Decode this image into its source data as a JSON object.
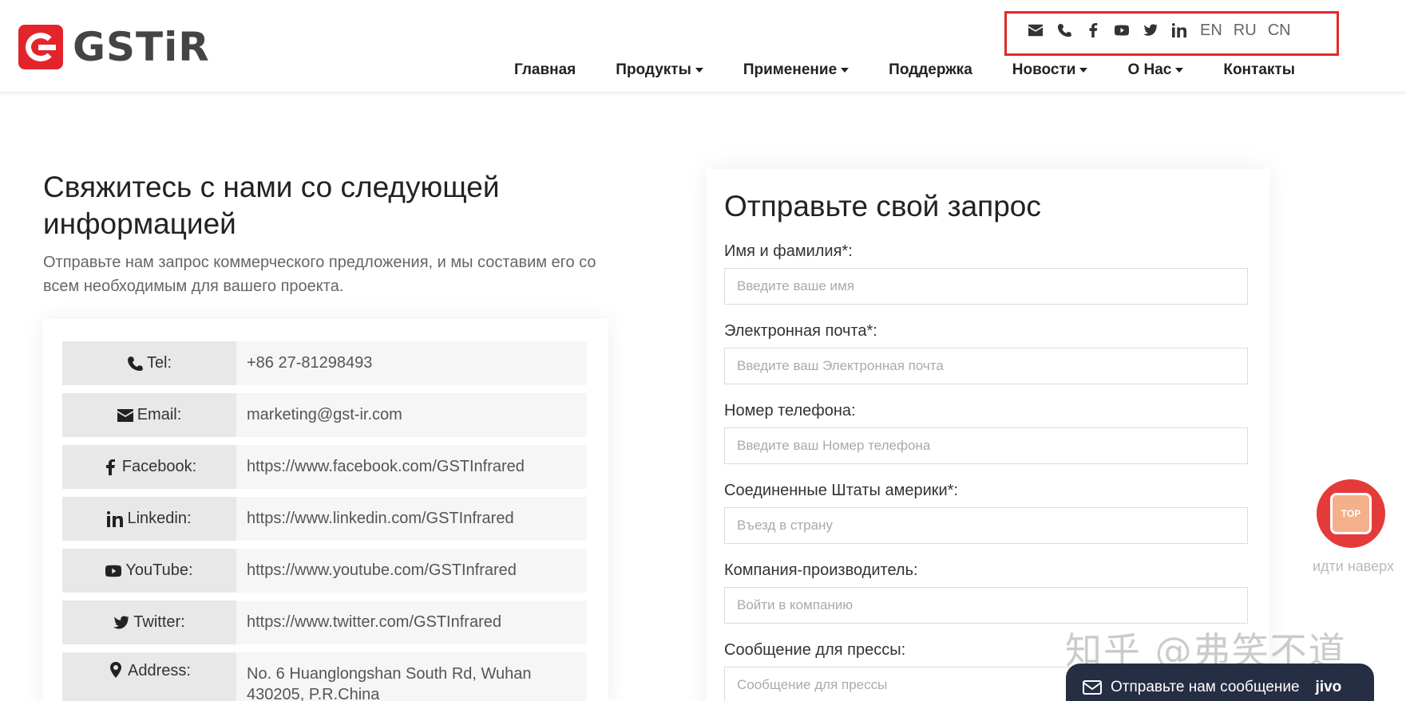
{
  "brand": {
    "logo_text": "GSTiR",
    "accent_color": "#e3242b"
  },
  "topbar": {
    "icons": [
      "envelope-icon",
      "phone-icon",
      "facebook-icon",
      "youtube-icon",
      "twitter-icon",
      "linkedin-icon"
    ],
    "languages": [
      "EN",
      "RU",
      "CN"
    ],
    "highlight_color": "#e02a2a"
  },
  "nav": {
    "items": [
      {
        "label": "Главная",
        "dropdown": false
      },
      {
        "label": "Продукты",
        "dropdown": true
      },
      {
        "label": "Применение",
        "dropdown": true
      },
      {
        "label": "Поддержка",
        "dropdown": false
      },
      {
        "label": "Новости",
        "dropdown": true
      },
      {
        "label": "О Нас",
        "dropdown": true
      },
      {
        "label": "Контакты",
        "dropdown": false
      }
    ]
  },
  "contact": {
    "title": "Свяжитесь с нами со следующей информацией",
    "description": "Отправьте нам запрос коммерческого предложения, и мы составим его со всем необходимым для вашего проекта.",
    "rows": [
      {
        "icon": "phone-icon",
        "label": "Tel:",
        "value": "+86 27-81298493"
      },
      {
        "icon": "envelope-icon",
        "label": "Email:",
        "value": "marketing@gst-ir.com"
      },
      {
        "icon": "facebook-icon",
        "label": "Facebook:",
        "value": "https://www.facebook.com/GSTInfrared"
      },
      {
        "icon": "linkedin-icon",
        "label": "Linkedin:",
        "value": "https://www.linkedin.com/GSTInfrared"
      },
      {
        "icon": "youtube-icon",
        "label": "YouTube:",
        "value": "https://www.youtube.com/GSTInfrared"
      },
      {
        "icon": "twitter-icon",
        "label": "Twitter:",
        "value": "https://www.twitter.com/GSTInfrared"
      },
      {
        "icon": "map-marker-icon",
        "label": "Address:",
        "value": "No. 6 Huanglongshan South Rd, Wuhan 430205, P.R.China"
      }
    ]
  },
  "form": {
    "title": "Отправьте свой запрос",
    "fields": [
      {
        "label": "Имя и фамилия*:",
        "placeholder": "Введите ваше имя",
        "value": ""
      },
      {
        "label": "Электронная почта*:",
        "placeholder": "Введите ваш Электронная почта",
        "value": ""
      },
      {
        "label": "Номер телефона:",
        "placeholder": "Введите ваш Номер телефона",
        "value": ""
      },
      {
        "label": "Соединенные Штаты америки*:",
        "placeholder": "Въезд в страну",
        "value": ""
      },
      {
        "label": "Компания-производитель:",
        "placeholder": "Войти в компанию",
        "value": ""
      },
      {
        "label": "Сообщение для прессы:",
        "placeholder": "Сообщение для прессы",
        "value": ""
      }
    ]
  },
  "back_to_top": {
    "badge": "TOP",
    "label": "идти наверх"
  },
  "watermark": "知乎 @弗笑不道",
  "chat": {
    "label": "Отправьте нам сообщение",
    "brand": "jivo"
  }
}
